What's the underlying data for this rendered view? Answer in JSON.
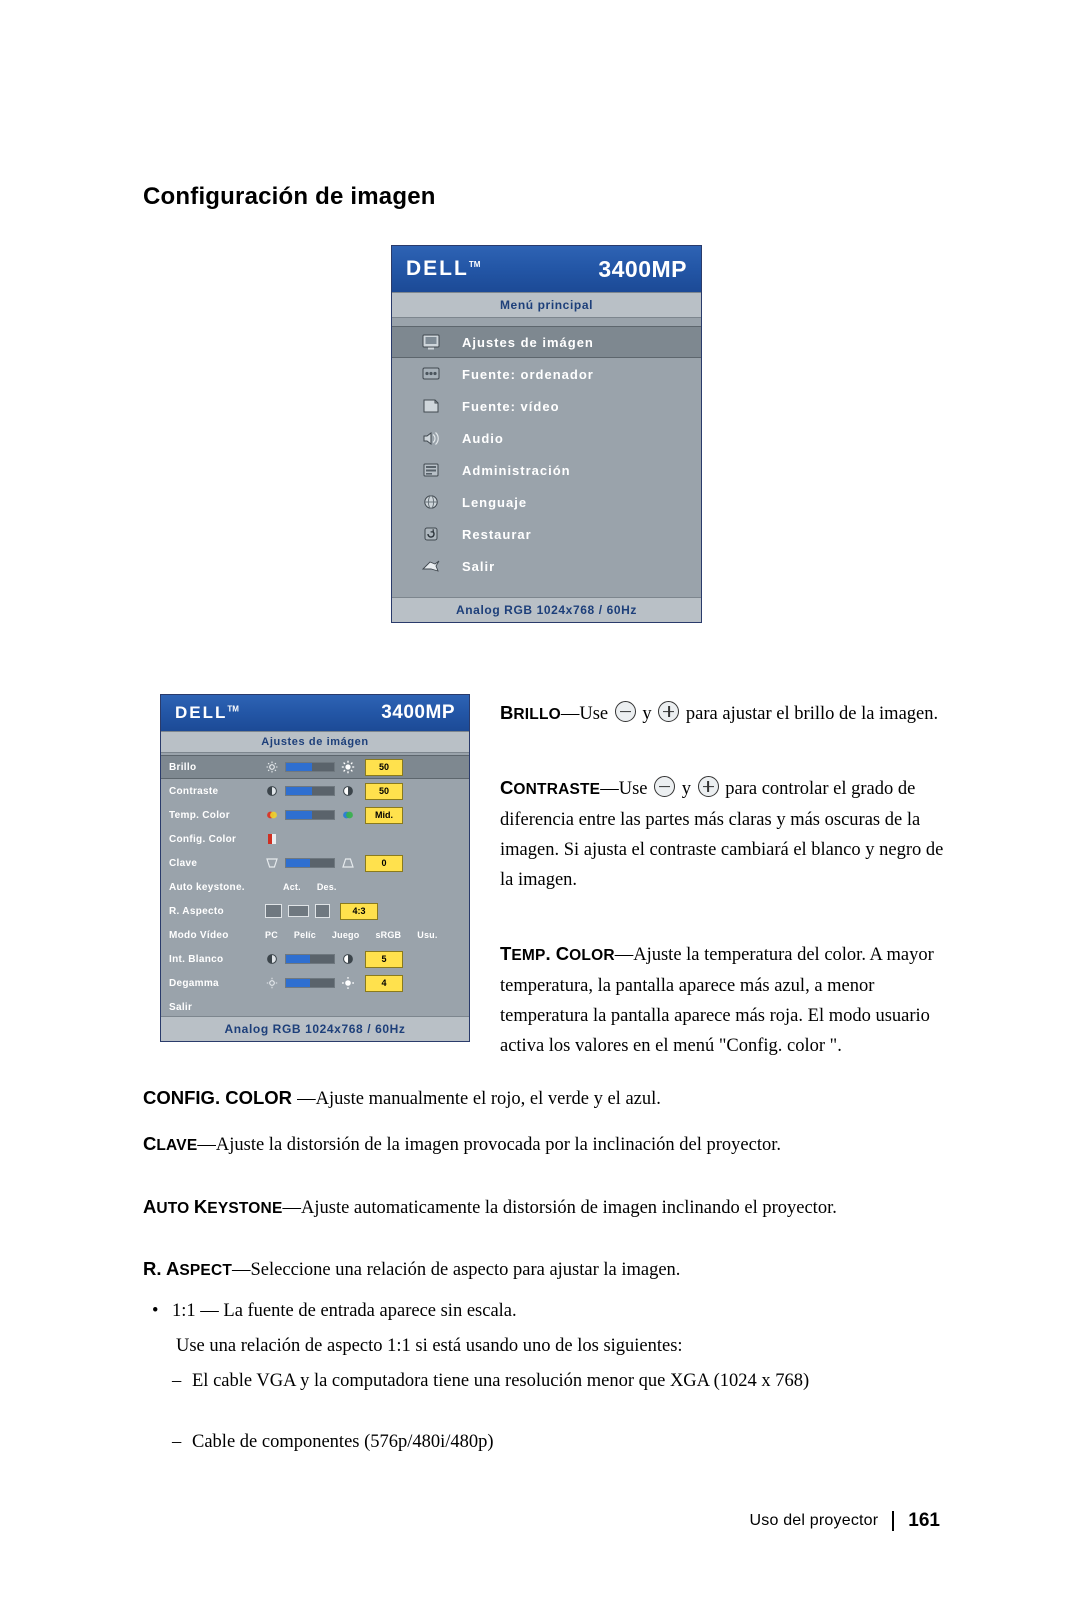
{
  "page": {
    "heading": "Configuración de imagen",
    "footer_text": "Uso del proyector",
    "footer_page": "161"
  },
  "osd_main": {
    "brand": "DELL",
    "brand_tm": "TM",
    "model": "3400MP",
    "subtitle": "Menú principal",
    "footer": "Analog RGB 1024x768 / 60Hz",
    "items": [
      {
        "label": "Ajustes de imágen",
        "icon": "image-settings-icon",
        "selected": true
      },
      {
        "label": "Fuente: ordenador",
        "icon": "computer-source-icon",
        "selected": false
      },
      {
        "label": "Fuente: vídeo",
        "icon": "video-source-icon",
        "selected": false
      },
      {
        "label": "Audio",
        "icon": "audio-icon",
        "selected": false
      },
      {
        "label": "Administración",
        "icon": "management-icon",
        "selected": false
      },
      {
        "label": "Lenguaje",
        "icon": "language-icon",
        "selected": false
      },
      {
        "label": "Restaurar",
        "icon": "reset-icon",
        "selected": false
      },
      {
        "label": "Salir",
        "icon": "exit-icon",
        "selected": false
      }
    ]
  },
  "osd_image": {
    "brand": "DELL",
    "brand_tm": "TM",
    "model": "3400MP",
    "subtitle": "Ajustes de imágen",
    "footer": "Analog RGB 1024x768 / 60Hz",
    "rows": [
      {
        "label": "Brillo",
        "type": "slider",
        "value": "50",
        "selected": true
      },
      {
        "label": "Contraste",
        "type": "slider",
        "value": "50",
        "selected": false
      },
      {
        "label": "Temp. Color",
        "type": "slider",
        "value": "Mid.",
        "selected": false
      },
      {
        "label": "Config. Color",
        "type": "icon",
        "value": "",
        "selected": false
      },
      {
        "label": "Clave",
        "type": "slider",
        "value": "0",
        "selected": false
      },
      {
        "label": "Auto keystone.",
        "type": "options",
        "options": [
          "Act.",
          "Des."
        ],
        "selected": false
      },
      {
        "label": "R. Aspecto",
        "type": "aspect",
        "value": "4:3",
        "selected": false
      },
      {
        "label": "Modo Vídeo",
        "type": "options",
        "options": [
          "PC",
          "Pelíc",
          "Juego",
          "sRGB",
          "Usu."
        ],
        "selected": false
      },
      {
        "label": "Int. Blanco",
        "type": "slider",
        "value": "5",
        "selected": false
      },
      {
        "label": "Degamma",
        "type": "slider",
        "value": "4",
        "selected": false
      },
      {
        "label": "Salir",
        "type": "none",
        "value": "",
        "selected": false
      }
    ]
  },
  "body": {
    "brillo_caps": "B",
    "brillo_rest": "RILLO",
    "brillo_text_1": "—Use ",
    "brillo_text_2": " y ",
    "brillo_text_3": " para ajustar el brillo de la imagen.",
    "contraste_caps": "C",
    "contraste_rest": "ONTRASTE",
    "contraste_text_1": "—Use ",
    "contraste_text_2": " y ",
    "contraste_text_3": " para controlar el grado de diferencia entre las partes más claras y más oscuras de la imagen. Si ajusta el contraste cambiará el blanco y negro de la imagen.",
    "temp_caps": "T",
    "temp_rest": "EMP",
    "temp_mid": ". C",
    "temp_rest2": "OLOR",
    "temp_text": "—Ajuste la temperatura del color. A mayor temperatura, la pantalla aparece más azul, a menor temperatura la pantalla aparece más roja. El modo usuario activa los valores en el menú \"Config. color \".",
    "config_color_label": "CONFIG. COLOR ",
    "config_color_text": "—Ajuste manualmente el rojo, el verde y el azul.",
    "clave_caps": "C",
    "clave_rest": "LAVE",
    "clave_text": "—Ajuste la distorsión de la imagen provocada por la inclinación del proyector.",
    "autokey_caps_1": "A",
    "autokey_rest_1": "UTO ",
    "autokey_caps_2": "K",
    "autokey_rest_2": "EYSTONE",
    "autokey_text": "—Ajuste automaticamente la distorsión de imagen inclinando el proyector.",
    "aspect_caps_1": "R. A",
    "aspect_rest_1": "SPECT",
    "aspect_text": "—Seleccione una relación de aspecto para ajustar la imagen.",
    "bullet_1": "1:1 — La fuente de entrada aparece sin escala.",
    "bullet_1_sub": "Use una relación de aspecto 1:1 si está usando uno de los siguientes:",
    "dash_1": "El cable VGA y la computadora tiene una resolución menor que XGA (1024 x 768)",
    "dash_2": "Cable de componentes (576p/480i/480p)"
  }
}
